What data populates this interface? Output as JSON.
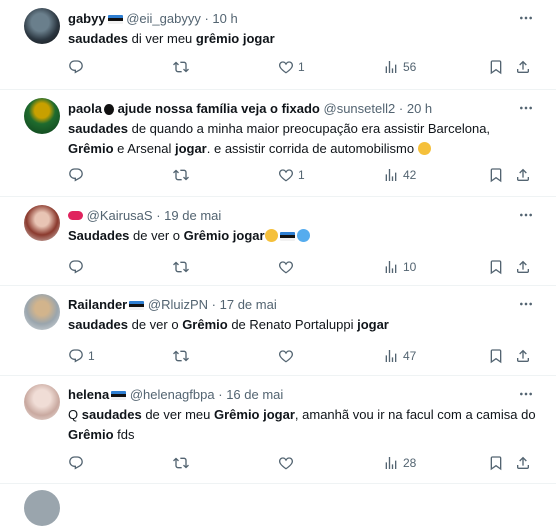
{
  "tweets": [
    {
      "name": "gabyy",
      "handle": "@eii_gabyyy",
      "time": "10 h",
      "segments": [
        {
          "t": "saudades",
          "b": true
        },
        {
          "t": " di ver meu ",
          "b": false
        },
        {
          "t": "grêmio",
          "b": true
        },
        {
          "t": " ",
          "b": false
        },
        {
          "t": "jogar",
          "b": true
        }
      ],
      "likes": "1",
      "views": "56"
    },
    {
      "name": "paola",
      "name_suffix": " ajude nossa família veja o fixado",
      "handle": "@sunsetell2",
      "time": "20 h",
      "segments": [
        {
          "t": "saudades",
          "b": true
        },
        {
          "t": " de quando a minha maior preocupação era assistir Barcelona, ",
          "b": false
        },
        {
          "t": "Grêmio",
          "b": true
        },
        {
          "t": " e Arsenal ",
          "b": false
        },
        {
          "t": "jogar",
          "b": true
        },
        {
          "t": ". e assistir corrida de automobilismo ",
          "b": false
        }
      ],
      "likes": "1",
      "views": "42"
    },
    {
      "name": "",
      "handle": "@KairusaS",
      "time": "19 de mai",
      "segments": [
        {
          "t": "Saudades",
          "b": true
        },
        {
          "t": " de ver o ",
          "b": false
        },
        {
          "t": "Grêmio",
          "b": true
        },
        {
          "t": " ",
          "b": false
        },
        {
          "t": "jogar",
          "b": true
        }
      ],
      "likes": "",
      "views": "10"
    },
    {
      "name": "Railander",
      "handle": "@RluizPN",
      "time": "17 de mai",
      "segments": [
        {
          "t": "saudades",
          "b": true
        },
        {
          "t": " de ver o ",
          "b": false
        },
        {
          "t": "Grêmio",
          "b": true
        },
        {
          "t": " de Renato Portaluppi ",
          "b": false
        },
        {
          "t": "jogar",
          "b": true
        }
      ],
      "replies": "1",
      "views": "47"
    },
    {
      "name": "helena",
      "handle": "@helenagfbpa",
      "time": "16 de mai",
      "segments": [
        {
          "t": "Q ",
          "b": false
        },
        {
          "t": "saudades",
          "b": true
        },
        {
          "t": " de ver meu ",
          "b": false
        },
        {
          "t": "Grêmio",
          "b": true
        },
        {
          "t": " ",
          "b": false
        },
        {
          "t": "jogar",
          "b": true
        },
        {
          "t": ", amanhã vou ir na facul com a camisa do ",
          "b": false
        },
        {
          "t": "Grêmio",
          "b": true
        },
        {
          "t": " fds",
          "b": false
        }
      ],
      "likes": "",
      "views": "28"
    }
  ],
  "colors": {
    "text": "#0f1419",
    "secondary": "#536471",
    "divider": "#eff3f4"
  },
  "icons": [
    "reply-icon",
    "retweet-icon",
    "like-icon",
    "views-icon",
    "bookmark-icon",
    "share-icon",
    "more-icon"
  ]
}
